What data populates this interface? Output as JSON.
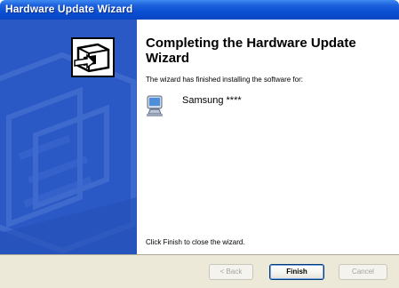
{
  "window": {
    "title": "Hardware Update Wizard"
  },
  "main": {
    "heading": "Completing the Hardware Update Wizard",
    "description": "The wizard has finished installing the software for:",
    "device_name": "Samsung ****",
    "closing_text": "Click Finish to close the wizard."
  },
  "buttons": {
    "back_label": "< Back",
    "finish_label": "Finish",
    "cancel_label": "Cancel"
  },
  "icons": {
    "wizard": "hardware-wizard-icon",
    "device": "monitor-icon"
  },
  "colors": {
    "titlebar": "#0a4fd3",
    "side_panel": "#2a58c4",
    "bottom_bar": "#ece9d8"
  }
}
